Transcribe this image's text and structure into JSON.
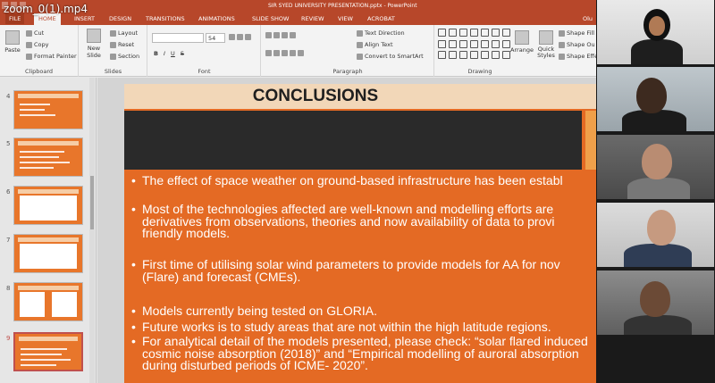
{
  "video_name": "zoom_0(1).mp4",
  "window_title": "SIR SYED UNIVERSITY PRESENTATION.pptx - PowerPoint",
  "user_name": "Olu",
  "ribbon_tabs": [
    "FILE",
    "HOME",
    "INSERT",
    "DESIGN",
    "TRANSITIONS",
    "ANIMATIONS",
    "SLIDE SHOW",
    "REVIEW",
    "VIEW",
    "ACROBAT"
  ],
  "active_tab": "HOME",
  "ribbon": {
    "clipboard": {
      "paste": "Paste",
      "cut": "Cut",
      "copy": "Copy",
      "format_painter": "Format Painter",
      "label": "Clipboard"
    },
    "slides": {
      "new_slide": "New Slide",
      "layout": "Layout",
      "reset": "Reset",
      "section": "Section",
      "label": "Slides"
    },
    "font": {
      "size": "54",
      "label": "Font"
    },
    "paragraph": {
      "text_direction": "Text Direction",
      "align_text": "Align Text",
      "smartart": "Convert to SmartArt",
      "label": "Paragraph"
    },
    "drawing": {
      "arrange": "Arrange",
      "quick_styles": "Quick Styles",
      "shape_fill": "Shape Fill",
      "shape_outline": "Shape Ou",
      "shape_effects": "Shape Effe",
      "label": "Drawing"
    }
  },
  "thumbnails": [
    {
      "num": "4",
      "selected": false
    },
    {
      "num": "5",
      "selected": false
    },
    {
      "num": "6",
      "selected": false
    },
    {
      "num": "7",
      "selected": false
    },
    {
      "num": "8",
      "selected": false
    },
    {
      "num": "9",
      "selected": true
    }
  ],
  "slide": {
    "title": "CONCLUSIONS",
    "bullets": [
      [
        "The effect of space weather on ground-based infrastructure has been establ"
      ],
      [
        "Most of the technologies affected are well-known and modelling efforts are",
        "derivatives from observations, theories and now availability of data to provi",
        "friendly models."
      ],
      [
        "First time of utilising solar wind parameters to provide models for AA for nov",
        "(Flare) and forecast (CMEs)."
      ],
      [
        "Models currently being tested on GLORIA."
      ],
      [
        "Future works is to study areas that are not within the high latitude regions."
      ],
      [
        "For analytical detail of the models presented, please check: “solar flared induced",
        "cosmic noise absorption (2018)” and “Empirical modelling of auroral absorption",
        "during disturbed periods of ICME- 2020”."
      ]
    ]
  },
  "colors": {
    "accent": "#b7472a",
    "slide_bg": "#e46a24",
    "title_bg": "#f2d7b8"
  }
}
